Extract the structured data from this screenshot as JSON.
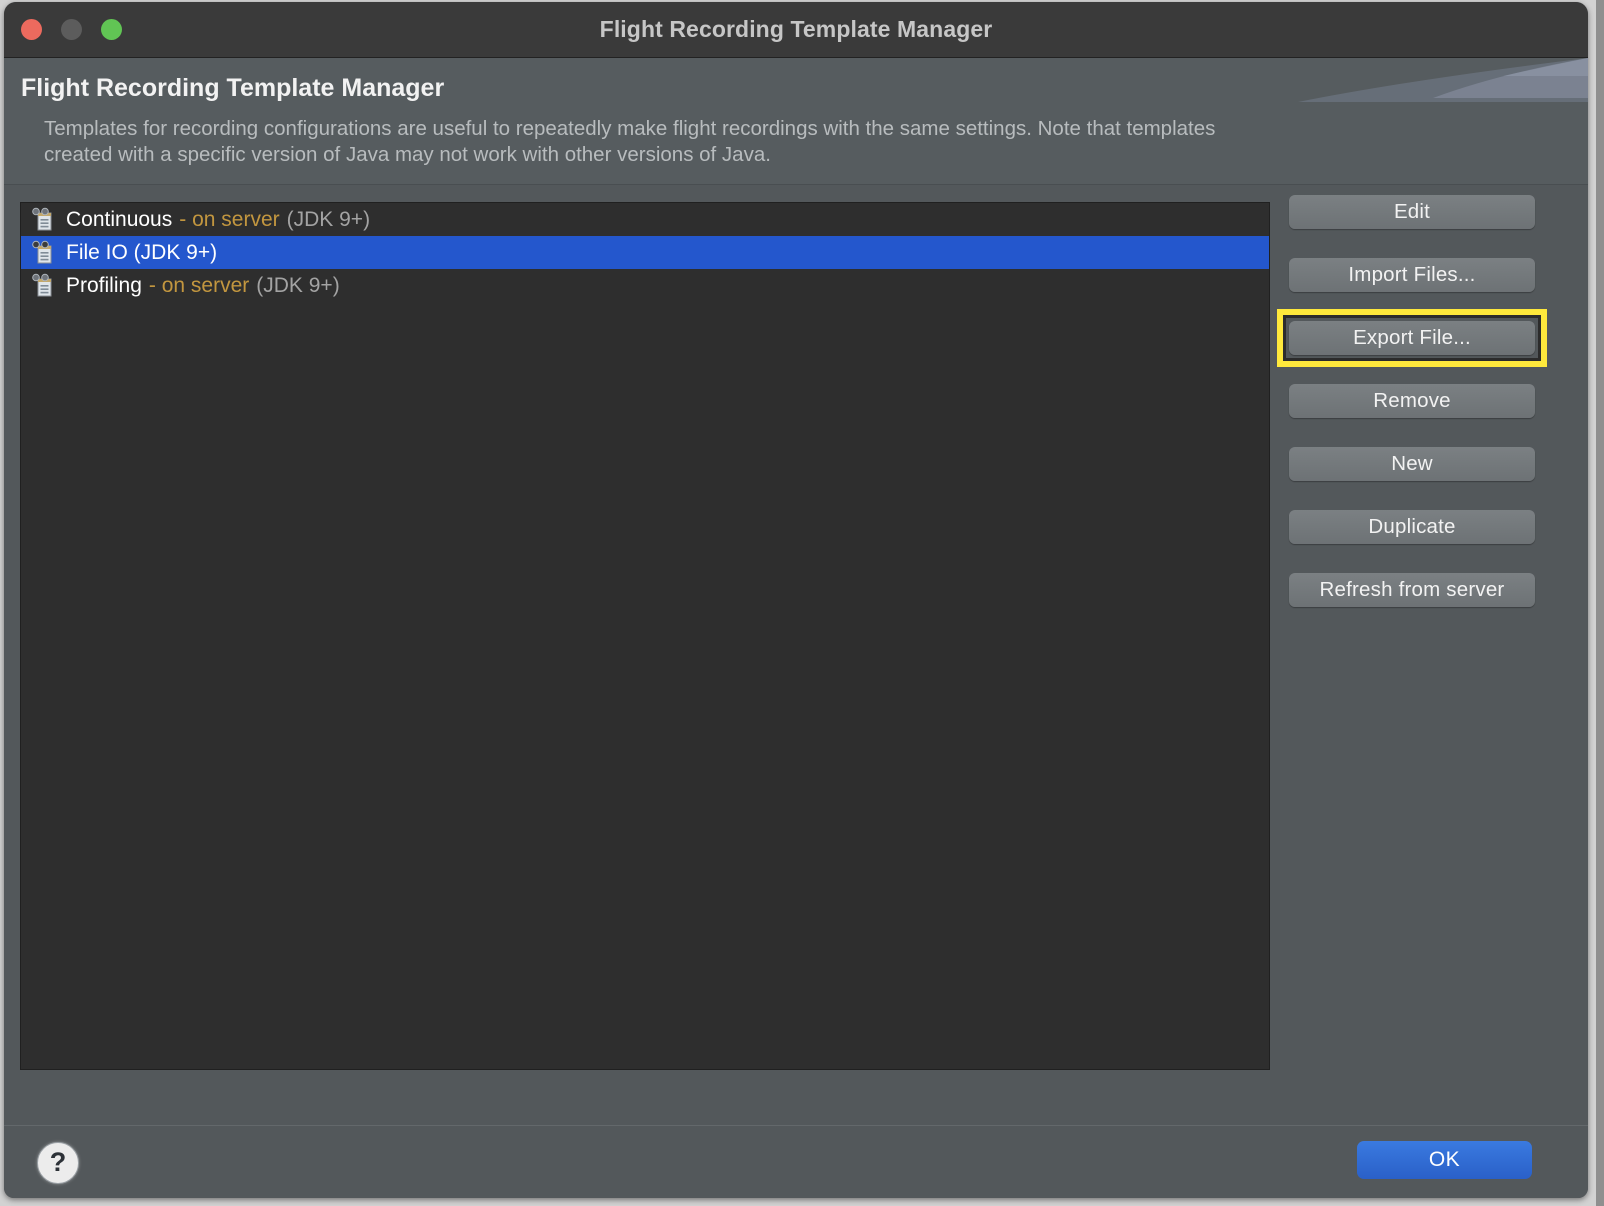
{
  "window": {
    "title": "Flight Recording Template Manager",
    "traffic_lights": [
      "close-button",
      "minimize-button",
      "zoom-button"
    ]
  },
  "header": {
    "title": "Flight Recording Template Manager",
    "description": "Templates for recording configurations are useful to repeatedly make flight recordings with the same settings. Note that templates created with a specific version of Java may not work with other versions of Java."
  },
  "templates": [
    {
      "name": "Continuous",
      "server": "- on server",
      "jdk": "(JDK 9+)",
      "selected": false
    },
    {
      "name": "File IO (JDK 9+)",
      "server": "",
      "jdk": "",
      "selected": true
    },
    {
      "name": "Profiling",
      "server": "- on server",
      "jdk": "(JDK 9+)",
      "selected": false
    }
  ],
  "buttons": {
    "edit": "Edit",
    "import": "Import Files...",
    "export": "Export File...",
    "remove": "Remove",
    "new": "New",
    "duplicate": "Duplicate",
    "refresh": "Refresh from server"
  },
  "footer": {
    "help": "?",
    "ok": "OK"
  },
  "colors": {
    "accent_blue": "#2457cd",
    "ok_blue": "#2a60c8",
    "highlight_yellow": "#ffe93c",
    "server_text": "#c2963f",
    "jdk_text": "#a3a3a3",
    "window_bg": "#53585b",
    "list_bg": "#2e2e2e",
    "titlebar_bg": "#3a3a3a"
  }
}
